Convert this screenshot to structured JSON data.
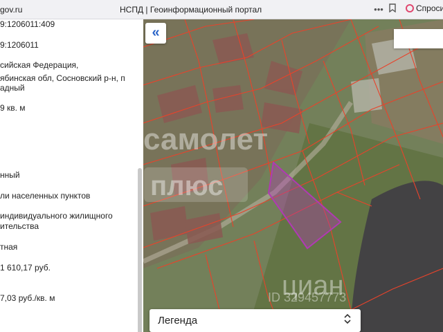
{
  "browser": {
    "url": "gov.ru",
    "tab_title": "НСПД | Геоинформационный портал",
    "ask_label": "Спроси",
    "icons": [
      "more-icon",
      "bookmark-icon",
      "ask-alice-icon"
    ]
  },
  "info_panel": {
    "lines": [
      "9:1206011:409",
      "9:1206011",
      "сийская Федерация,",
      "ябинская обл, Сосновский р-н, п",
      "адный",
      "9 кв. м",
      "нный",
      "ли населенных пунктов",
      "индивидуального жилищного",
      "ительства",
      "тная",
      "1 610,17 руб.",
      "7,03 руб./кв. м"
    ]
  },
  "map": {
    "collapse_label": "«",
    "watermarks": [
      "самолет",
      "плюс",
      "циан",
      "ID 329457773"
    ],
    "legend_label": "Легенда",
    "legend_toggle": "⌃⌄",
    "colors": {
      "parcel_border": "#e8432b",
      "selected_parcel": "#b03ab3"
    }
  }
}
